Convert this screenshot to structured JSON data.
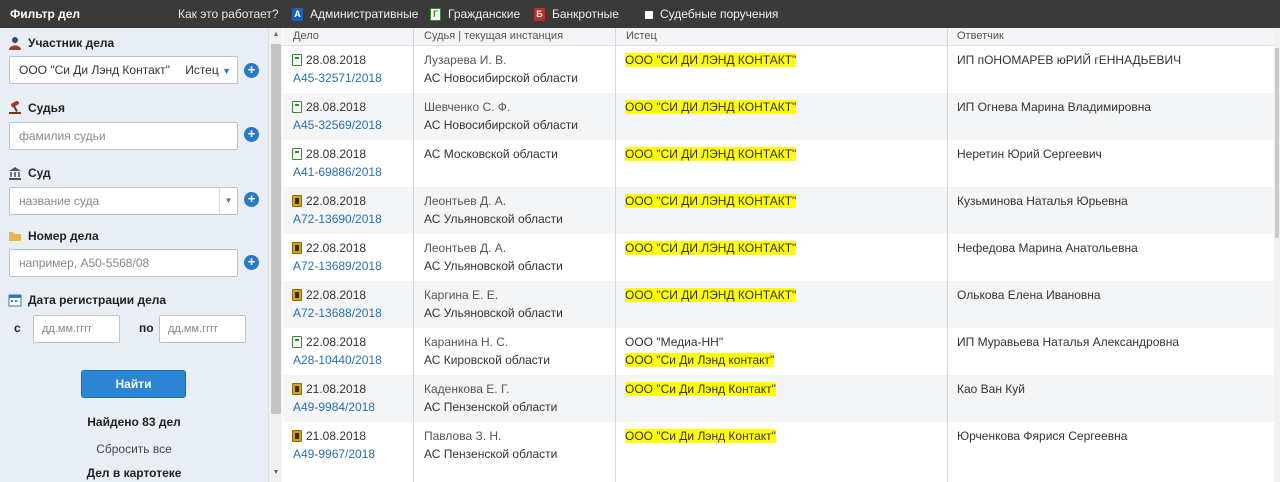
{
  "topbar": {
    "title": "Фильтр дел",
    "how_link": "Как это работает?",
    "filters": [
      {
        "icon": "A",
        "label": "Административные"
      },
      {
        "icon": "Г",
        "label": "Гражданские"
      },
      {
        "icon": "Б",
        "label": "Банкротные"
      },
      {
        "icon": "",
        "label": "Судебные поручения"
      }
    ]
  },
  "sidebar": {
    "participant_label": "Участник дела",
    "participant_value": "ООО \"Си Ди Лэнд Контакт\"",
    "participant_role": "Истец",
    "judge_label": "Судья",
    "judge_placeholder": "фамилия судьи",
    "court_label": "Суд",
    "court_placeholder": "название суда",
    "case_label": "Номер дела",
    "case_placeholder": "например, А50-5568/08",
    "date_label": "Дата регистрации дела",
    "from_label": "с",
    "to_label": "по",
    "date_placeholder": "дд.мм.гггг",
    "find_button": "Найти",
    "found_text": "Найдено 83 дел",
    "reset_text": "Сбросить все",
    "in_card_text": "Дел в картотеке"
  },
  "table": {
    "headers": [
      "Дело",
      "Судья | текущая инстанция",
      "Истец",
      "Ответчик"
    ],
    "rows": [
      {
        "type": "civil",
        "date": "28.08.2018",
        "number": "А45-32571/2018",
        "judge": "Лузарева И. В.",
        "court": "АС Новосибирской области",
        "plaintiff": [
          "ООО \"СИ ДИ ЛЭНД КОНТАКТ\""
        ],
        "plaintiff_hl": [
          true
        ],
        "defendant": "ИП пОНОМАРЕВ юРИЙ гЕННАДЬЕВИЧ"
      },
      {
        "type": "civil",
        "date": "28.08.2018",
        "number": "А45-32569/2018",
        "judge": "Шевченко С. Ф.",
        "court": "АС Новосибирской области",
        "plaintiff": [
          "ООО \"СИ ДИ ЛЭНД КОНТАКТ\""
        ],
        "plaintiff_hl": [
          true
        ],
        "defendant": "ИП Огнева Марина Владимировна"
      },
      {
        "type": "civil",
        "date": "28.08.2018",
        "number": "А41-69886/2018",
        "judge": "",
        "court": "АС Московской области",
        "plaintiff": [
          "ООО \"СИ ДИ ЛЭНД КОНТАКТ\""
        ],
        "plaintiff_hl": [
          true
        ],
        "defendant": "Неретин Юрий Сергеевич"
      },
      {
        "type": "bank",
        "date": "22.08.2018",
        "number": "А72-13690/2018",
        "judge": "Леонтьев Д. А.",
        "court": "АС Ульяновской области",
        "plaintiff": [
          "ООО \"СИ ДИ ЛЭНД КОНТАКТ\""
        ],
        "plaintiff_hl": [
          true
        ],
        "defendant": "Кузьминова Наталья Юрьевна"
      },
      {
        "type": "bank",
        "date": "22.08.2018",
        "number": "А72-13689/2018",
        "judge": "Леонтьев Д. А.",
        "court": "АС Ульяновской области",
        "plaintiff": [
          "ООО \"СИ ДИ ЛЭНД КОНТАКТ\""
        ],
        "plaintiff_hl": [
          true
        ],
        "defendant": "Нефедова Марина Анатольевна"
      },
      {
        "type": "bank",
        "date": "22.08.2018",
        "number": "А72-13688/2018",
        "judge": "Каргина Е. Е.",
        "court": "АС Ульяновской области",
        "plaintiff": [
          "ООО \"СИ ДИ ЛЭНД КОНТАКТ\""
        ],
        "plaintiff_hl": [
          true
        ],
        "defendant": "Олькова Елена Ивановна"
      },
      {
        "type": "civil",
        "date": "22.08.2018",
        "number": "А28-10440/2018",
        "judge": "Каранина Н. С.",
        "court": "АС Кировской области",
        "plaintiff": [
          "ООО \"Медиа-НН\"",
          "ООО \"Си Ди Лэнд контакт\""
        ],
        "plaintiff_hl": [
          false,
          true
        ],
        "defendant": "ИП Муравьева Наталья Александровна"
      },
      {
        "type": "bank",
        "date": "21.08.2018",
        "number": "А49-9984/2018",
        "judge": "Каденкова Е. Г.",
        "court": "АС Пензенской области",
        "plaintiff": [
          "ООО \"Си Ди Лэнд Контакт\""
        ],
        "plaintiff_hl": [
          true
        ],
        "defendant": "Као Ван Куй"
      },
      {
        "type": "bank",
        "date": "21.08.2018",
        "number": "А49-9967/2018",
        "judge": "Павлова З. Н.",
        "court": "АС Пензенской области",
        "plaintiff": [
          "ООО \"Си Ди Лэнд Контакт\""
        ],
        "plaintiff_hl": [
          true
        ],
        "defendant": "Юрченкова Фярися Сергеевна"
      }
    ]
  },
  "colors": {
    "topbar": "#3a3a3a",
    "sidebar": "#e9eef5",
    "link": "#2b6fb3",
    "highlight": "#ffff00",
    "button": "#2a86d4"
  }
}
